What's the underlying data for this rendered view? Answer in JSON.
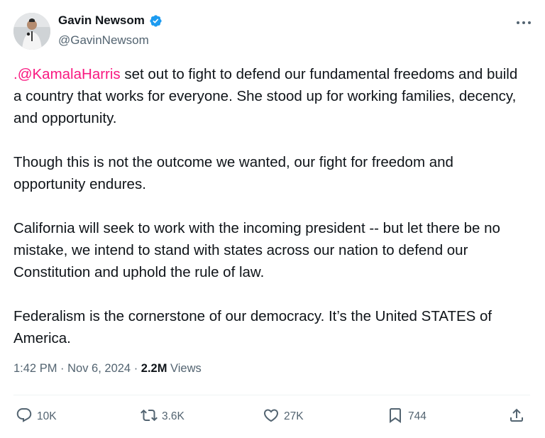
{
  "author": {
    "display_name": "Gavin Newsom",
    "handle": "@GavinNewsom",
    "verified": true
  },
  "tweet": {
    "mention": ".@KamalaHarris",
    "paragraph1_rest": " set out to fight to defend our fundamental freedoms and build a country that works for everyone. She stood up for working families, decency, and opportunity.",
    "paragraph2": "Though this is not the outcome we wanted, our fight for freedom and opportunity endures.",
    "paragraph3": "California will seek to work with the incoming president -- but let there be no mistake, we intend to stand with states across our nation to defend our Constitution and uphold the rule of law.",
    "paragraph4": "Federalism is the cornerstone of our democracy. It’s the United STATES of America."
  },
  "meta": {
    "time": "1:42 PM",
    "separator1": " · ",
    "date": "Nov 6, 2024",
    "separator2": " · ",
    "views_count": "2.2M",
    "views_label": " Views"
  },
  "actions": {
    "replies": "10K",
    "reposts": "3.6K",
    "likes": "27K",
    "bookmarks": "744"
  },
  "colors": {
    "mention": "#f91880",
    "verified": "#1d9bf0",
    "secondary_text": "#536471",
    "primary_text": "#0f1419"
  },
  "icons": {
    "more": "more-icon",
    "verified": "verified-badge-icon",
    "reply": "reply-icon",
    "repost": "repost-icon",
    "like": "heart-icon",
    "bookmark": "bookmark-icon",
    "share": "share-icon"
  }
}
